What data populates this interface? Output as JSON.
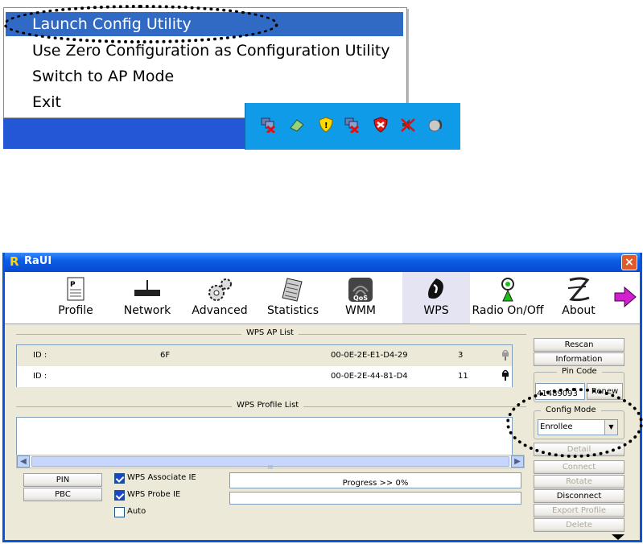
{
  "context_menu": {
    "items": [
      {
        "label": "Launch Config Utility",
        "selected": true
      },
      {
        "label": "Use Zero Configuration as Configuration Utility",
        "selected": false
      },
      {
        "label": "Switch to AP Mode",
        "selected": false
      },
      {
        "label": "Exit",
        "selected": false
      }
    ]
  },
  "tray": {
    "icons": [
      "network-disconnected-icon",
      "network-icon",
      "security-shield-icon",
      "network-disconnected-icon",
      "firewall-icon",
      "volume-muted-icon",
      "wireless-utility-icon"
    ]
  },
  "window": {
    "logo": "R",
    "title": "RaUI",
    "close": "×"
  },
  "toolbar": {
    "items": [
      "Profile",
      "Network",
      "Advanced",
      "Statistics",
      "WMM",
      "WPS",
      "Radio On/Off",
      "About"
    ],
    "active": "WPS"
  },
  "wps_ap_list": {
    "legend": "WPS AP List",
    "rows": [
      {
        "id_label": "ID :",
        "ssid": "6F",
        "bssid": "00-0E-2E-E1-D4-29",
        "channel": "3"
      },
      {
        "id_label": "ID :",
        "ssid": "",
        "bssid": "00-0E-2E-44-81-D4",
        "channel": "11"
      }
    ]
  },
  "wps_profile_list": {
    "legend": "WPS Profile List",
    "scroll_mark": "III"
  },
  "buttons": {
    "pin": "PIN",
    "pbc": "PBC",
    "rescan": "Rescan",
    "information": "Information",
    "renew": "Renew",
    "detail": "Detail",
    "connect": "Connect",
    "rotate": "Rotate",
    "disconnect": "Disconnect",
    "export_profile": "Export Profile",
    "delete": "Delete"
  },
  "options": {
    "wps_associate_ie": "WPS Associate IE",
    "wps_probe_ie": "WPS Probe IE",
    "auto": "Auto"
  },
  "pin_code": {
    "legend": "Pin Code",
    "value": "41489093"
  },
  "config_mode": {
    "legend": "Config Mode",
    "value": "Enrollee"
  },
  "progress": {
    "label": "Progress >> 0%",
    "value": 0
  }
}
